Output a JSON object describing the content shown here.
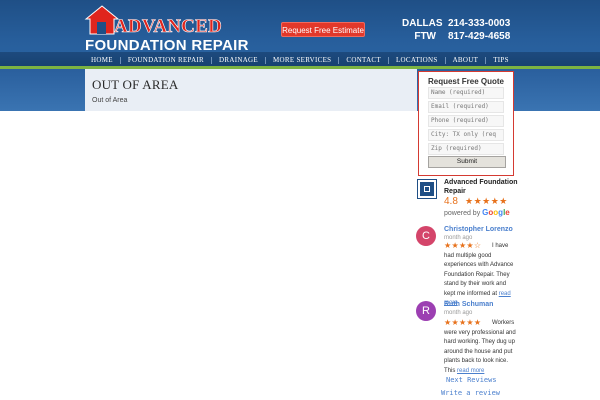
{
  "brand": {
    "line1": "ADVANCED",
    "line2": "FOUNDATION REPAIR",
    "logo_icon": "house-icon",
    "colors": {
      "red": "#e0251d",
      "blue": "#1f4f86",
      "green": "#7cb342"
    }
  },
  "header": {
    "estimate_button": "Request Free Estimate",
    "phones": [
      {
        "city": "DALLAS",
        "number": "214-333-0003"
      },
      {
        "city": "FTW",
        "number": "817-429-4658"
      }
    ]
  },
  "nav": {
    "items": [
      "HOME",
      "FOUNDATION REPAIR",
      "DRAINAGE",
      "MORE SERVICES",
      "CONTACT",
      "LOCATIONS",
      "ABOUT",
      "TIPS"
    ]
  },
  "page": {
    "title": "OUT OF AREA",
    "body": "Out of Area"
  },
  "quote_form": {
    "title": "Request Free Quote",
    "fields": [
      {
        "placeholder": "Name (required)"
      },
      {
        "placeholder": "Email (required)"
      },
      {
        "placeholder": "Phone (required)"
      },
      {
        "placeholder": "City: TX only (req"
      },
      {
        "placeholder": "Zip (required)"
      }
    ],
    "submit_label": "Submit"
  },
  "google_widget": {
    "business_name": "Advanced Foundation Repair",
    "rating": "4.8",
    "stars": "★★★★★",
    "powered_by": "powered by",
    "google_letters": [
      "G",
      "o",
      "o",
      "g",
      "l",
      "e"
    ],
    "next_reviews": "Next Reviews",
    "write_review": "Write a review",
    "reviews": [
      {
        "initial": "C",
        "avatar_color": "#d4456a",
        "name": "Christopher Lorenzo",
        "date": "month ago",
        "stars": "★★★★☆",
        "text": "I have had multiple good experiences with Advance Foundation Repair. They stand by their work and kept me informed at",
        "more": "read more"
      },
      {
        "initial": "R",
        "avatar_color": "#9c3fb2",
        "name": "Ruth Schuman",
        "date": "month ago",
        "stars": "★★★★★",
        "text": "Workers were very professional and hard working. They dug up around the house and put plants back to look nice. This",
        "more": "read more"
      }
    ]
  }
}
